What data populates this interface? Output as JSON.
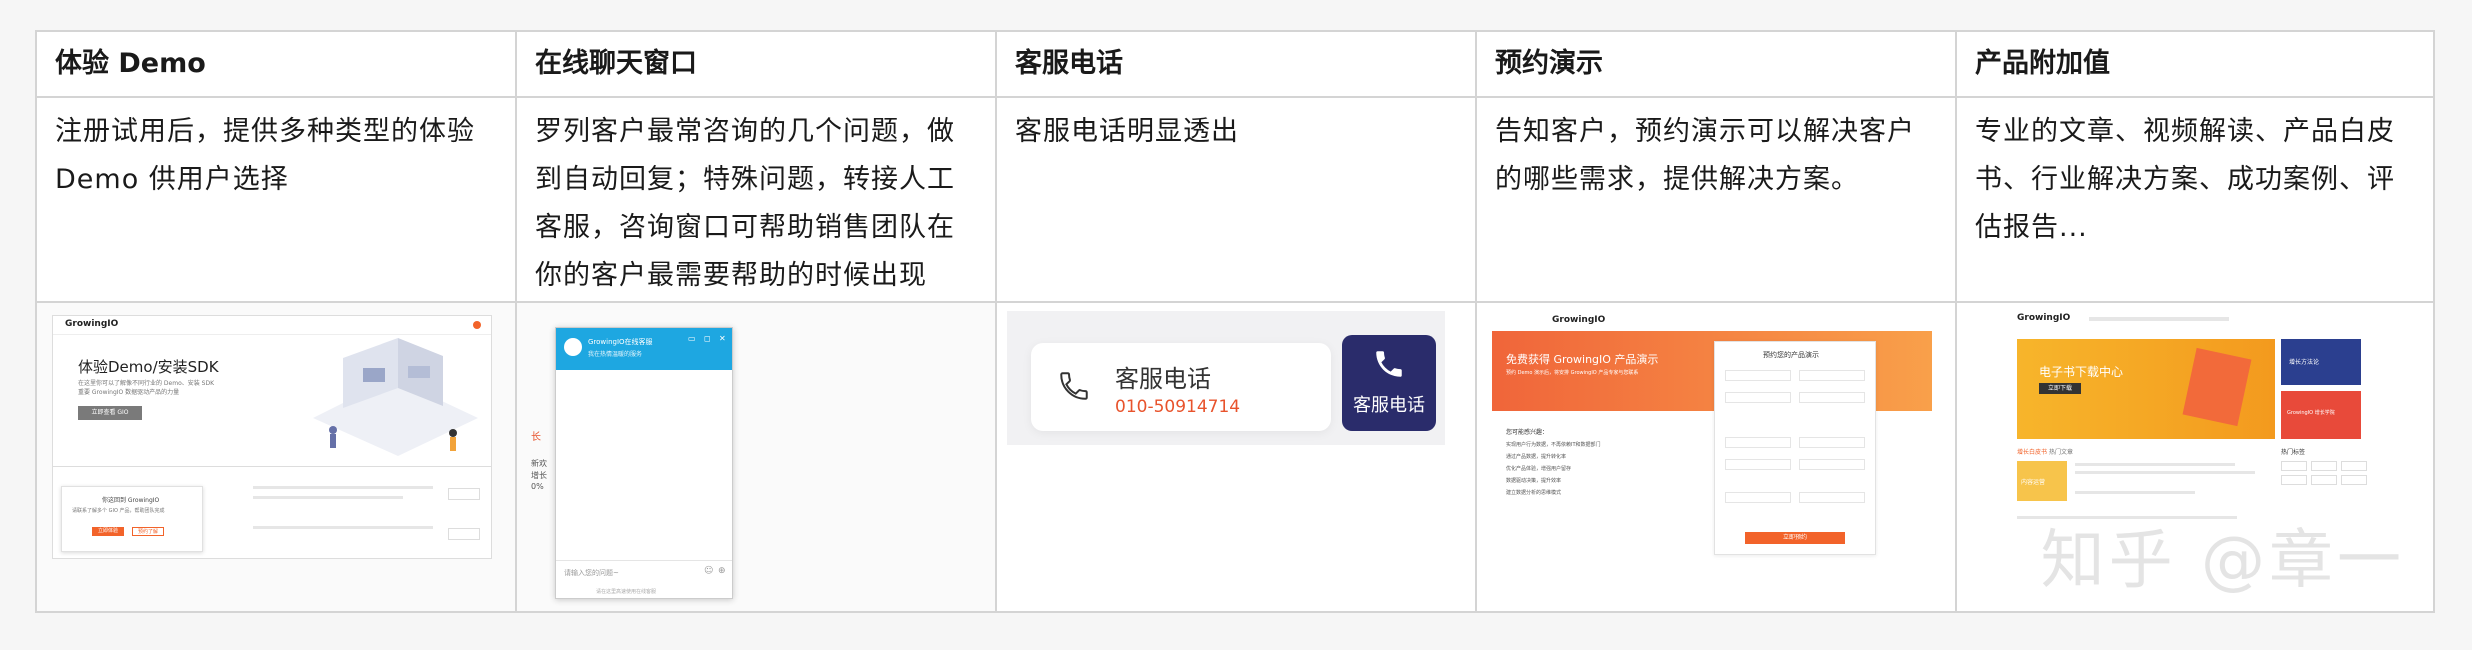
{
  "headers": [
    "体验 Demo",
    "在线聊天窗口",
    "客服电话",
    "预约演示",
    "产品附加值"
  ],
  "descriptions": [
    "注册试用后，提供多种类型的体验 Demo 供用户选择",
    "罗列客户最常咨询的几个问题，做到自动回复；特殊问题，转接人工客服，咨询窗口可帮助销售团队在你的客户最需要帮助的时候出现",
    "客服电话明显透出",
    "告知客户，预约演示可以解决客户的哪些需求，提供解决方案。",
    "专业的文章、视频解读、产品白皮书、行业解决方案、成功案例、评估报告..."
  ],
  "shot1": {
    "logo": "GrowingIO",
    "heading": "体验Demo/安装SDK",
    "sub1": "在这里你可以了解像不同行业的 Demo、安装 SDK",
    "sub2": "重要 GrowingIO 数据驱动产品的力量",
    "cta": "立即查看 GIO",
    "popup_title": "你这回到 GrowingIO",
    "popup_text": "请联系了解多个 GIO 产品，帮助团队完成",
    "popup_btn1": "立即体验",
    "popup_btn2": "预约了解"
  },
  "shot2": {
    "title": "GrowingIO在线客服",
    "subtitle": "我在热情温暖的服务",
    "side_char": "长",
    "side1": "新欢",
    "side2": "增长",
    "side3": "0%",
    "input_placeholder": "请输入您的问题~",
    "footer": "请在这里高速使用在线客服"
  },
  "shot3": {
    "label": "客服电话",
    "phone": "010-50914714",
    "badge_label": "客服电话",
    "accent": "#e8532c",
    "badge_color": "#2a2c6b"
  },
  "shot4": {
    "logo": "GrowingIO",
    "banner_title": "免费获得 GrowingIO 产品演示",
    "banner_sub": "预约 Demo 演示后，将安排 GrowingIO 产品专家与您联系",
    "form_title": "预约您的产品演示",
    "list_title": "您可能感兴趣：",
    "items": [
      "实现用户行为数据，不再依赖IT和数据部门",
      "通过产品数据，提升转化率",
      "优化产品体验，增强用户留存",
      "数据驱动决策，提升效率",
      "建立数据分析的思维模式"
    ],
    "submit": "立即预约"
  },
  "shot5": {
    "logo": "GrowingIO",
    "banner_title": "电子书下载中心",
    "banner_btn": "立即下载",
    "side1": "增长方法论",
    "side2": "GrowingIO 增长学院",
    "tab1": "增长白皮书",
    "tab2": "热门文章",
    "hot": "热门标签",
    "card": "内容运营"
  },
  "watermark": "知乎 @章一",
  "colors": {
    "border": "#d4d4d4",
    "orange": "#f2632a",
    "chat_blue": "#1ea7e1",
    "yellow": "#f7b52b"
  }
}
